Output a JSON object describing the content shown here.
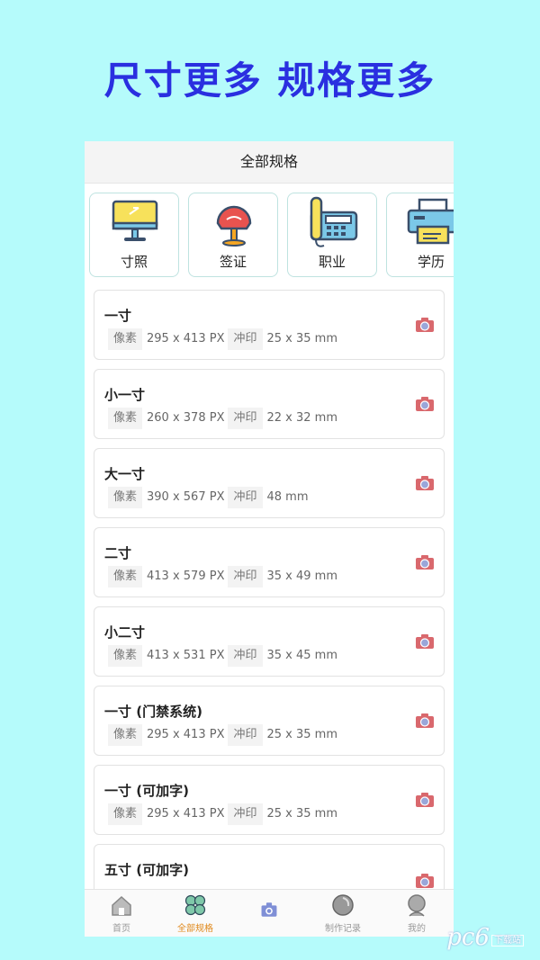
{
  "headline": "尺寸更多 规格更多",
  "title": "全部规格",
  "categories": [
    {
      "label": "寸照",
      "icon": "monitor-icon"
    },
    {
      "label": "签证",
      "icon": "pushpin-icon"
    },
    {
      "label": "职业",
      "icon": "telephone-icon"
    },
    {
      "label": "学历",
      "icon": "printer-icon"
    }
  ],
  "spec_labels": {
    "pixel": "像素",
    "print": "冲印"
  },
  "specs": [
    {
      "name": "一寸",
      "pixels": "295 x 413 PX",
      "print": "25 x 35 mm"
    },
    {
      "name": "小一寸",
      "pixels": "260 x 378 PX",
      "print": "22 x 32 mm"
    },
    {
      "name": "大一寸",
      "pixels": "390 x 567 PX",
      "print": "48 mm"
    },
    {
      "name": "二寸",
      "pixels": "413 x 579 PX",
      "print": "35 x 49 mm"
    },
    {
      "name": "小二寸",
      "pixels": "413 x 531 PX",
      "print": "35 x 45 mm"
    },
    {
      "name": "一寸 (门禁系统)",
      "pixels": "295 x 413 PX",
      "print": "25 x 35 mm"
    },
    {
      "name": "一寸 (可加字)",
      "pixels": "295 x 413 PX",
      "print": "25 x 35 mm"
    },
    {
      "name": "五寸 (可加字)",
      "pixels": "",
      "print": ""
    }
  ],
  "tabs": [
    {
      "label": "首页",
      "icon": "home-icon"
    },
    {
      "label": "全部规格",
      "icon": "clover-icon"
    },
    {
      "label": "",
      "icon": "camera-icon"
    },
    {
      "label": "制作记录",
      "icon": "record-icon"
    },
    {
      "label": "我的",
      "icon": "user-icon"
    }
  ],
  "watermark": "pc6",
  "watermark_small": "下载站",
  "colors": {
    "background": "#b5fbfb",
    "headline": "#2a2fe0",
    "active_tab": "#e08a1e",
    "camera": "#d9686d"
  }
}
